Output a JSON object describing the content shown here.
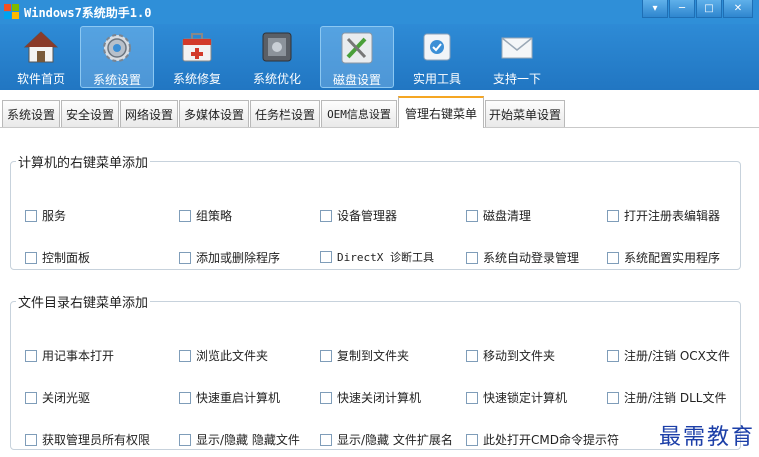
{
  "window": {
    "title": "Windows7系统助手1.0",
    "controls": [
      "▾",
      "─",
      "□",
      "✕"
    ]
  },
  "toolbar": {
    "items": [
      {
        "label": "软件首页",
        "icon": "house-icon"
      },
      {
        "label": "系统设置",
        "icon": "gear-icon",
        "active": true
      },
      {
        "label": "系统修复",
        "icon": "medkit-icon"
      },
      {
        "label": "系统优化",
        "icon": "chip-icon"
      },
      {
        "label": "磁盘设置",
        "icon": "tools-icon",
        "active": true
      },
      {
        "label": "实用工具",
        "icon": "utility-icon"
      },
      {
        "label": "支持一下",
        "icon": "mail-icon"
      }
    ]
  },
  "tabs": [
    {
      "label": "系统设置"
    },
    {
      "label": "安全设置"
    },
    {
      "label": "网络设置"
    },
    {
      "label": "多媒体设置"
    },
    {
      "label": "任务栏设置"
    },
    {
      "label": "OEM信息设置"
    },
    {
      "label": "管理右键菜单",
      "active": true
    },
    {
      "label": "开始菜单设置"
    }
  ],
  "groups": [
    {
      "title": "计算机的右键菜单添加",
      "rows": [
        [
          "服务",
          "组策略",
          "设备管理器",
          "磁盘清理",
          "打开注册表编辑器"
        ],
        [
          "控制面板",
          "添加或删除程序",
          "DirectX 诊断工具",
          "系统自动登录管理",
          "系统配置实用程序"
        ]
      ]
    },
    {
      "title": "文件目录右键菜单添加",
      "rows": [
        [
          "用记事本打开",
          "浏览此文件夹",
          "复制到文件夹",
          "移动到文件夹",
          "注册/注销 OCX文件"
        ],
        [
          "关闭光驱",
          "快速重启计算机",
          "快速关闭计算机",
          "快速锁定计算机",
          "注册/注销 DLL文件"
        ],
        [
          "获取管理员所有权限",
          "显示/隐藏 隐藏文件",
          "显示/隐藏 文件扩展名",
          "此处打开CMD命令提示符"
        ]
      ]
    }
  ],
  "watermark": "最需教育",
  "colors": {
    "titlebar": "#2f8fd8",
    "toolbar": "#2176c2",
    "active_tab_accent": "#f5a623"
  }
}
